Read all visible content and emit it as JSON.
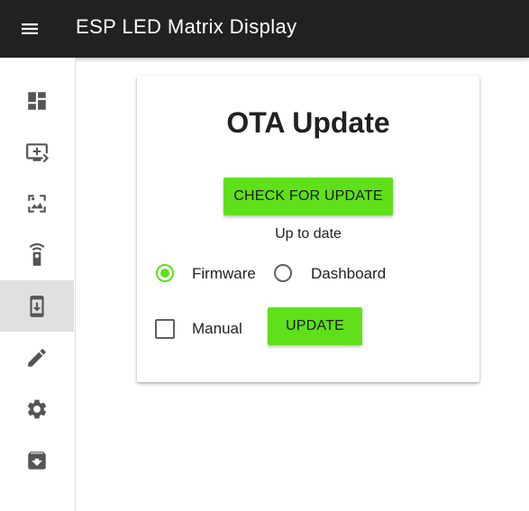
{
  "app": {
    "title": "ESP LED Matrix Display"
  },
  "nav": {
    "items": [
      {
        "icon": "dashboard-icon",
        "active": false
      },
      {
        "icon": "add-to-display-icon",
        "active": false
      },
      {
        "icon": "image-icon",
        "active": false
      },
      {
        "icon": "remote-icon",
        "active": false
      },
      {
        "icon": "system-update-icon",
        "active": true
      },
      {
        "icon": "pencil-icon",
        "active": false
      },
      {
        "icon": "gear-icon",
        "active": false
      },
      {
        "icon": "archive-icon",
        "active": false
      }
    ]
  },
  "ota": {
    "title": "OTA Update",
    "check_label": "CHECK FOR UPDATE",
    "status": "Up to date",
    "options": {
      "firmware_label": "Firmware",
      "firmware_checked": true,
      "dashboard_label": "Dashboard",
      "dashboard_checked": false
    },
    "manual_label": "Manual",
    "manual_checked": false,
    "update_label": "UPDATE"
  },
  "colors": {
    "appbar": "#212121",
    "accent": "#5fe01a",
    "icon": "#555555",
    "active_nav_bg": "#e0e0e0"
  }
}
